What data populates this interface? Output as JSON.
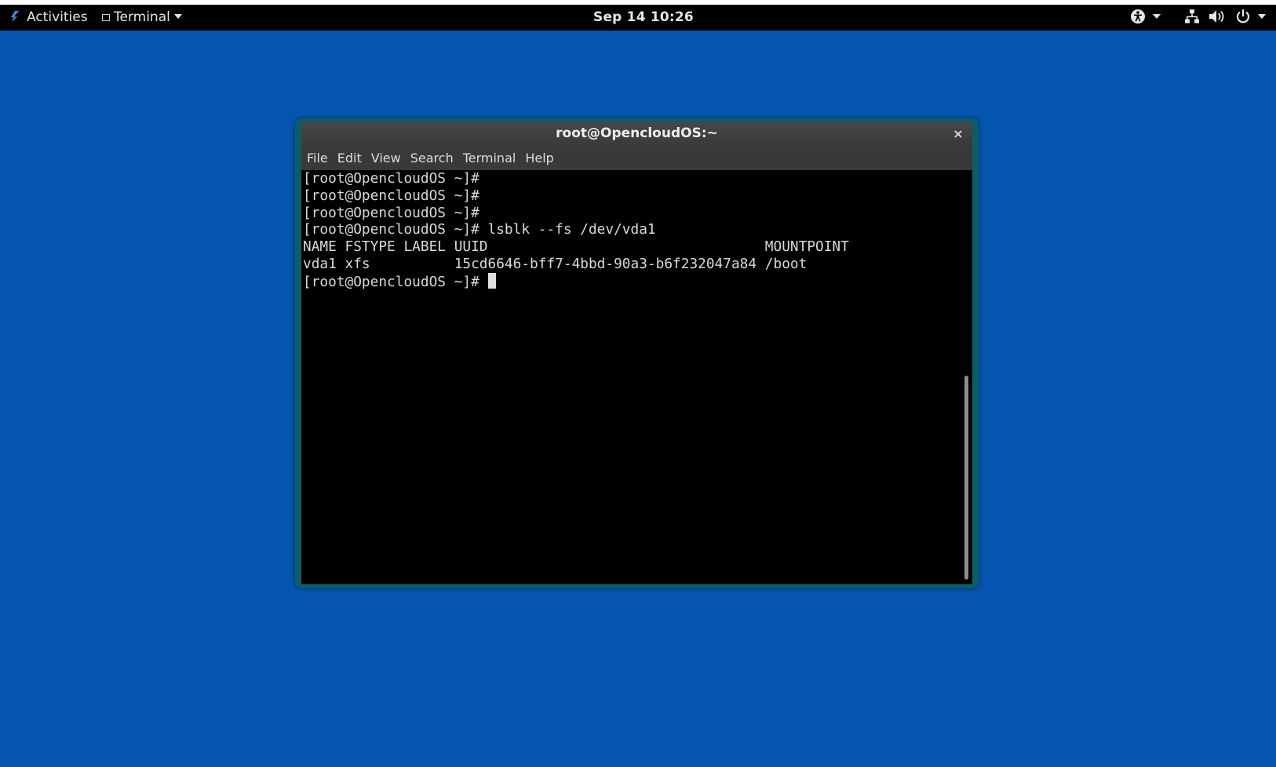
{
  "topbar": {
    "activities_label": "Activities",
    "app_menu_label": "Terminal",
    "clock": "Sep 14  10:26"
  },
  "window": {
    "title": "root@OpencloudOS:~",
    "close_glyph": "×",
    "menus": [
      "File",
      "Edit",
      "View",
      "Search",
      "Terminal",
      "Help"
    ]
  },
  "terminal": {
    "lines": [
      "[root@OpencloudOS ~]#",
      "[root@OpencloudOS ~]#",
      "[root@OpencloudOS ~]#",
      "[root@OpencloudOS ~]# lsblk --fs /dev/vda1",
      "NAME FSTYPE LABEL UUID                                 MOUNTPOINT",
      "vda1 xfs          15cd6646-bff7-4bbd-90a3-b6f232047a84 /boot"
    ],
    "prompt": "[root@OpencloudOS ~]# "
  },
  "icons": {
    "activities": "activities-logo-icon",
    "accessibility": "accessibility-icon",
    "network": "network-icon",
    "volume": "volume-icon",
    "power": "power-icon"
  },
  "colors": {
    "desktop": "#0455b0",
    "window_frame": "#0c5d66",
    "terminal_bg": "#000000",
    "terminal_fg": "#d9d9d9"
  }
}
